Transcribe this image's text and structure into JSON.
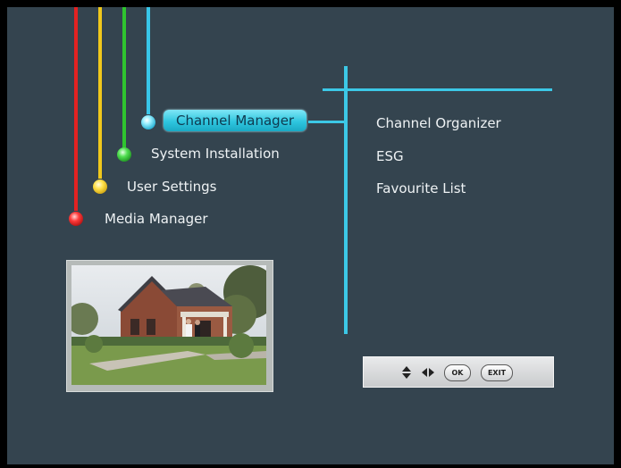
{
  "main_menu": {
    "items": [
      {
        "label": "Channel Manager",
        "color": "#38c6e8",
        "selected": true
      },
      {
        "label": "System Installation",
        "color": "#2fc52f",
        "selected": false
      },
      {
        "label": "User Settings",
        "color": "#f0c81c",
        "selected": false
      },
      {
        "label": "Media Manager",
        "color": "#e42222",
        "selected": false
      }
    ]
  },
  "submenu": {
    "items": [
      {
        "label": "Channel Organizer"
      },
      {
        "label": "ESG"
      },
      {
        "label": "Favourite List"
      }
    ]
  },
  "preview": {
    "icon": "house-video-preview"
  },
  "keybar": {
    "nav_up_down_icon": "up-down-arrows-icon",
    "nav_left_right_icon": "left-right-arrows-icon",
    "ok_label": "OK",
    "exit_label": "EXIT"
  },
  "colors": {
    "background": "#34444f",
    "accent": "#3cc8e6"
  }
}
